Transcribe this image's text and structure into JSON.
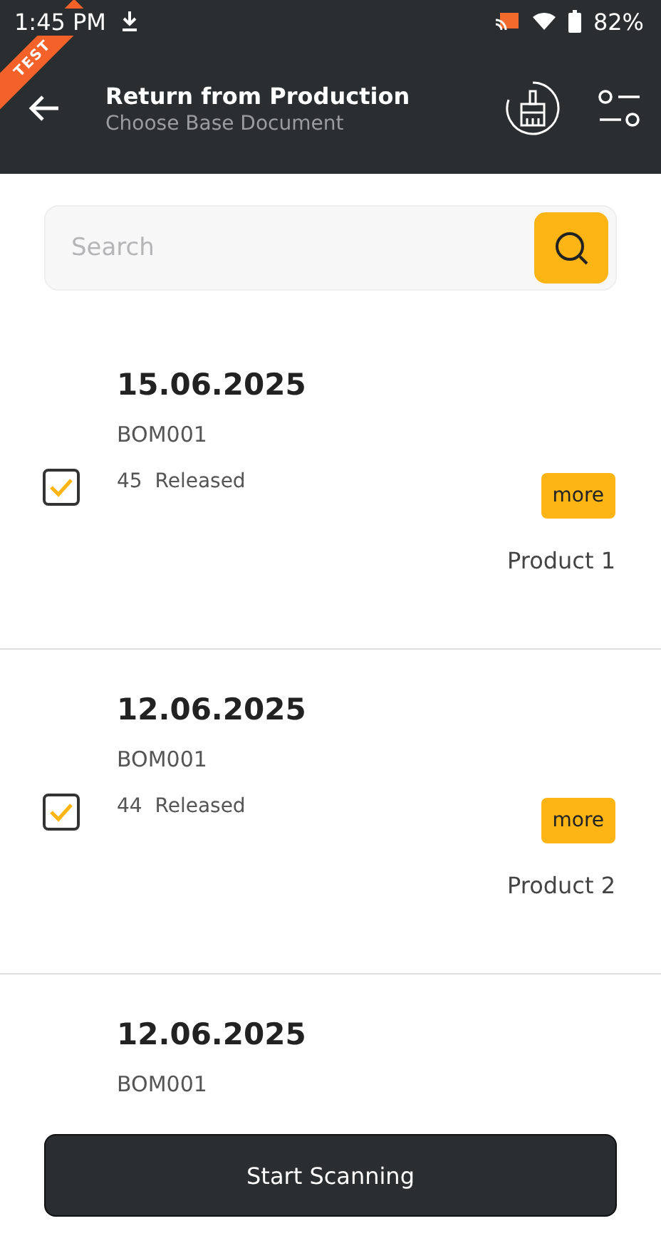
{
  "status_bar": {
    "time": "1:45 PM",
    "battery": "82%"
  },
  "ribbon": {
    "label": "TEST"
  },
  "header": {
    "title": "Return from Production",
    "subtitle": "Choose Base Document"
  },
  "search": {
    "placeholder": "Search"
  },
  "documents": [
    {
      "date": "15.06.2025",
      "code": "BOM001",
      "number": "45",
      "status": "Released",
      "product": "Product 1",
      "checked": true,
      "action": "more"
    },
    {
      "date": "12.06.2025",
      "code": "BOM001",
      "number": "44",
      "status": "Released",
      "product": "Product 2",
      "checked": true,
      "action": "more"
    },
    {
      "date": "12.06.2025",
      "code": "BOM001"
    }
  ],
  "primary_button": {
    "label": "Start Scanning"
  }
}
